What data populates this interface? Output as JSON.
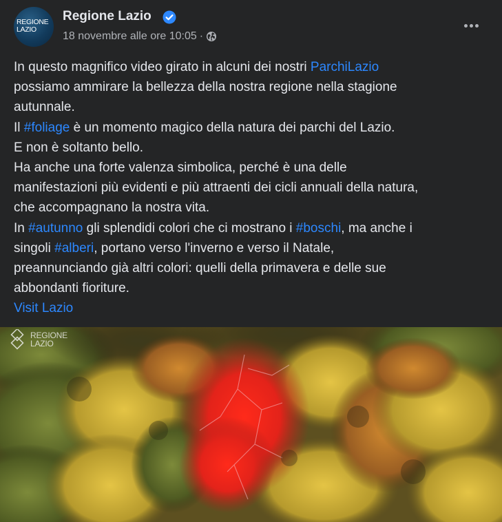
{
  "page": {
    "name": "Regione Lazio",
    "avatar_text_line1": "REGIONE",
    "avatar_text_line2": "LAZIO",
    "verified": true,
    "timestamp": "18 novembre alle ore 10:05",
    "separator": "·",
    "privacy_icon": "globe-icon",
    "more_icon": "more-options-icon"
  },
  "post": {
    "lines": [
      [
        {
          "t": "In questo magnifico video girato in alcuni dei nostri "
        },
        {
          "t": "ParchiLazio",
          "link": true
        }
      ],
      [
        {
          "t": "possiamo ammirare la bellezza della nostra regione nella stagione"
        }
      ],
      [
        {
          "t": "autunnale."
        }
      ],
      [
        {
          "t": "Il "
        },
        {
          "t": "#foliage",
          "link": true
        },
        {
          "t": " è un momento magico della natura dei parchi del Lazio."
        }
      ],
      [
        {
          "t": "E non è soltanto bello."
        }
      ],
      [
        {
          "t": "Ha anche una forte valenza simbolica, perché è una delle"
        }
      ],
      [
        {
          "t": "manifestazioni più evidenti e più attraenti dei cicli annuali della natura,"
        }
      ],
      [
        {
          "t": "che accompagnano la nostra vita."
        }
      ],
      [
        {
          "t": "In "
        },
        {
          "t": "#autunno",
          "link": true
        },
        {
          "t": " gli splendidi colori che ci mostrano i "
        },
        {
          "t": "#boschi",
          "link": true
        },
        {
          "t": ", ma anche i"
        }
      ],
      [
        {
          "t": "singoli "
        },
        {
          "t": "#alberi",
          "link": true
        },
        {
          "t": ", portano verso l'inverno e verso il Natale,"
        }
      ],
      [
        {
          "t": "preannunciando già altri colori: quelli della primavera e delle sue"
        }
      ],
      [
        {
          "t": "abbondanti fioriture."
        }
      ],
      [
        {
          "t": "Visit Lazio",
          "link": true
        }
      ]
    ]
  },
  "media": {
    "watermark_line1": "REGIONE",
    "watermark_line2": "LAZIO"
  },
  "colors": {
    "background": "#242526",
    "text": "#e4e6eb",
    "secondary_text": "#b0b3b8",
    "link": "#2d88ff",
    "verified_badge": "#2d88ff"
  }
}
